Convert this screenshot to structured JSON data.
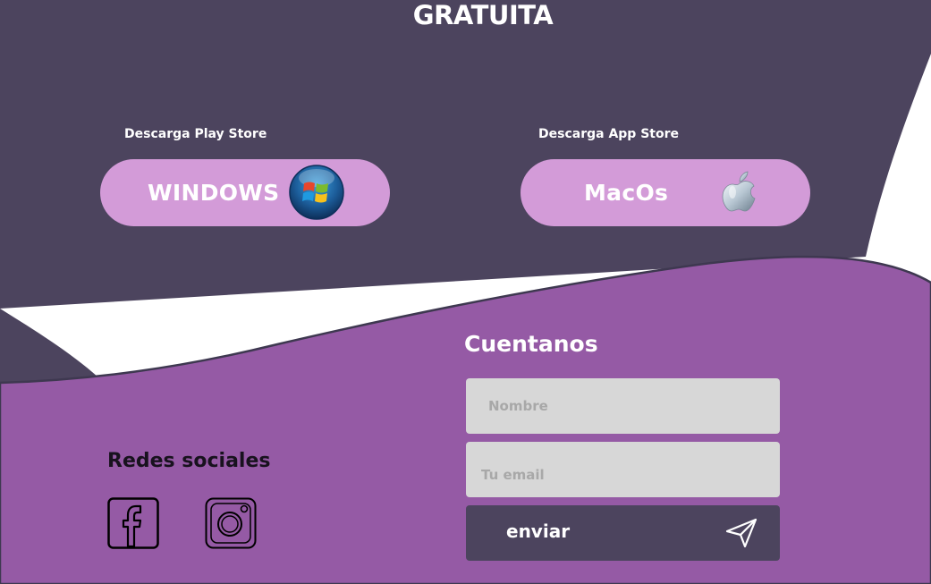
{
  "header": {
    "title": "GRATUITA"
  },
  "downloads": {
    "play_store": {
      "caption": "Descarga Play Store",
      "button_label": "WINDOWS",
      "icon": "windows-logo-icon"
    },
    "app_store": {
      "caption": "Descarga App Store",
      "button_label": "MacOs",
      "icon": "apple-logo-icon"
    }
  },
  "social": {
    "title": "Redes sociales",
    "icons": [
      "facebook-icon",
      "instagram-icon"
    ]
  },
  "contact": {
    "title": "Cuentanos",
    "name_placeholder": "Nombre",
    "email_placeholder": "Tu email",
    "submit_label": "enviar",
    "submit_icon": "send-icon"
  },
  "colors": {
    "dark_section": "#4c445e",
    "purple_section": "#955aa5",
    "button_pink": "#d39bd8",
    "input_gray": "#d7d7d7",
    "text_white": "#ffffff",
    "text_dark": "#18121e"
  }
}
